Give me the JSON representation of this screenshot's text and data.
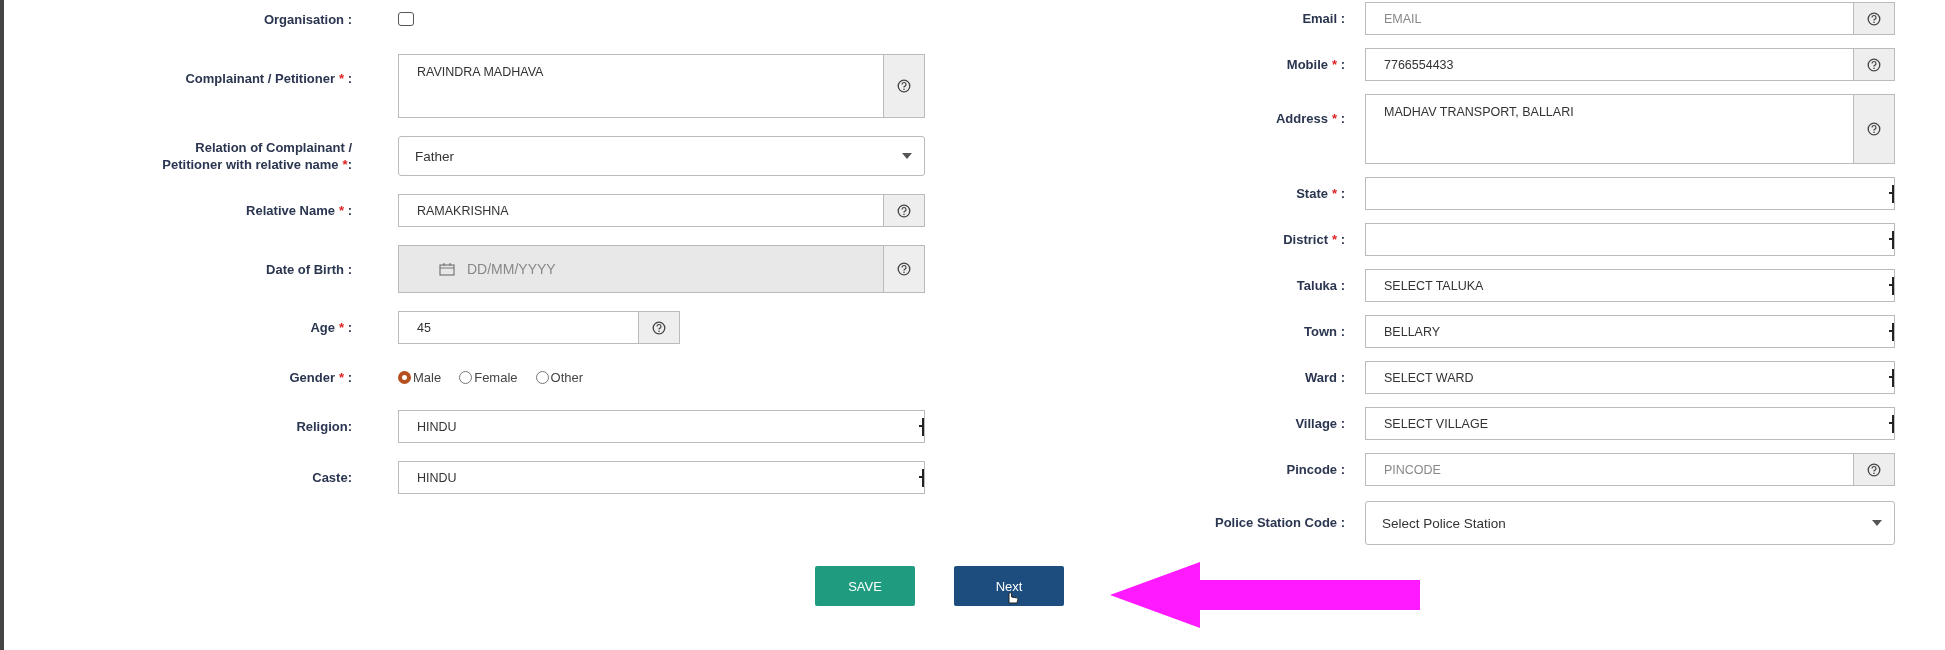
{
  "left_fields": [
    {
      "kind": "checkbox",
      "label": "Organisation :",
      "checked": false
    },
    {
      "kind": "textarea",
      "label": "Complainant / Petitioner",
      "required_mark": "*",
      "label_end": " :",
      "value": "RAVINDRA MADHAVA",
      "help": true
    },
    {
      "kind": "dropdown",
      "label": "Relation of Complainant / Petitioner with relative name",
      "required_mark": "*",
      "label_end": ":",
      "value": "Father"
    },
    {
      "kind": "text",
      "label": "Relative Name",
      "required_mark": "*",
      "label_end": " :",
      "value": "RAMAKRISHNA",
      "help": true
    },
    {
      "kind": "date",
      "label": "Date of Birth :",
      "placeholder": "DD/MM/YYYY",
      "help": true
    },
    {
      "kind": "number",
      "label": "Age",
      "required_mark": "*",
      "label_end": " :",
      "value": "45",
      "help": true
    },
    {
      "kind": "radio",
      "label": "Gender",
      "required_mark": "*",
      "label_end": " :",
      "options": [
        {
          "label": "Male",
          "selected": true
        },
        {
          "label": "Female",
          "selected": false
        },
        {
          "label": "Other",
          "selected": false
        }
      ]
    },
    {
      "kind": "combo",
      "label": "Religion:",
      "value": "HINDU"
    },
    {
      "kind": "combo",
      "label": "Caste:",
      "value": "HINDU"
    }
  ],
  "right_fields": [
    {
      "kind": "text",
      "label": "Email :",
      "placeholder": "EMAIL",
      "help": true
    },
    {
      "kind": "text",
      "label": "Mobile",
      "required_mark": "*",
      "label_end": " :",
      "value": "7766554433",
      "help": true
    },
    {
      "kind": "textarea",
      "label": "Address",
      "required_mark": "*",
      "label_end": " :",
      "value": "MADHAV TRANSPORT, BALLARI",
      "help": true
    },
    {
      "kind": "combo",
      "label": "State",
      "required_mark": "*",
      "label_end": " :"
    },
    {
      "kind": "combo",
      "label": "District",
      "required_mark": "*",
      "label_end": " :"
    },
    {
      "kind": "combo",
      "label": "Taluka :",
      "value": "SELECT TALUKA"
    },
    {
      "kind": "combo",
      "label": "Town :",
      "value": "BELLARY"
    },
    {
      "kind": "combo",
      "label": "Ward :",
      "value": "SELECT WARD"
    },
    {
      "kind": "combo",
      "label": "Village :",
      "value": "SELECT VILLAGE"
    },
    {
      "kind": "text",
      "label": "Pincode :",
      "placeholder": "PINCODE",
      "help": true
    },
    {
      "kind": "dropdown",
      "label": "Police Station Code :",
      "value": "Select Police Station"
    }
  ],
  "buttons": [
    {
      "kind": "save",
      "label": "SAVE"
    },
    {
      "kind": "next",
      "label": "Next"
    }
  ]
}
